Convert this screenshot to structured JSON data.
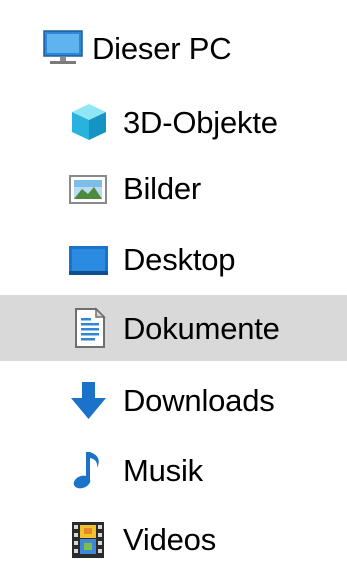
{
  "navigation_pane": {
    "root": {
      "label": "Dieser PC",
      "icon": "monitor-icon"
    },
    "items": [
      {
        "label": "3D-Objekte",
        "icon": "3d-cube-icon"
      },
      {
        "label": "Bilder",
        "icon": "picture-icon"
      },
      {
        "label": "Desktop",
        "icon": "desktop-icon"
      },
      {
        "label": "Dokumente",
        "icon": "document-icon",
        "selected": true
      },
      {
        "label": "Downloads",
        "icon": "download-arrow-icon"
      },
      {
        "label": "Musik",
        "icon": "music-note-icon"
      },
      {
        "label": "Videos",
        "icon": "film-icon"
      }
    ],
    "colors": {
      "selection_background": "#d9d9d9",
      "accent_blue": "#1a73c9"
    }
  }
}
